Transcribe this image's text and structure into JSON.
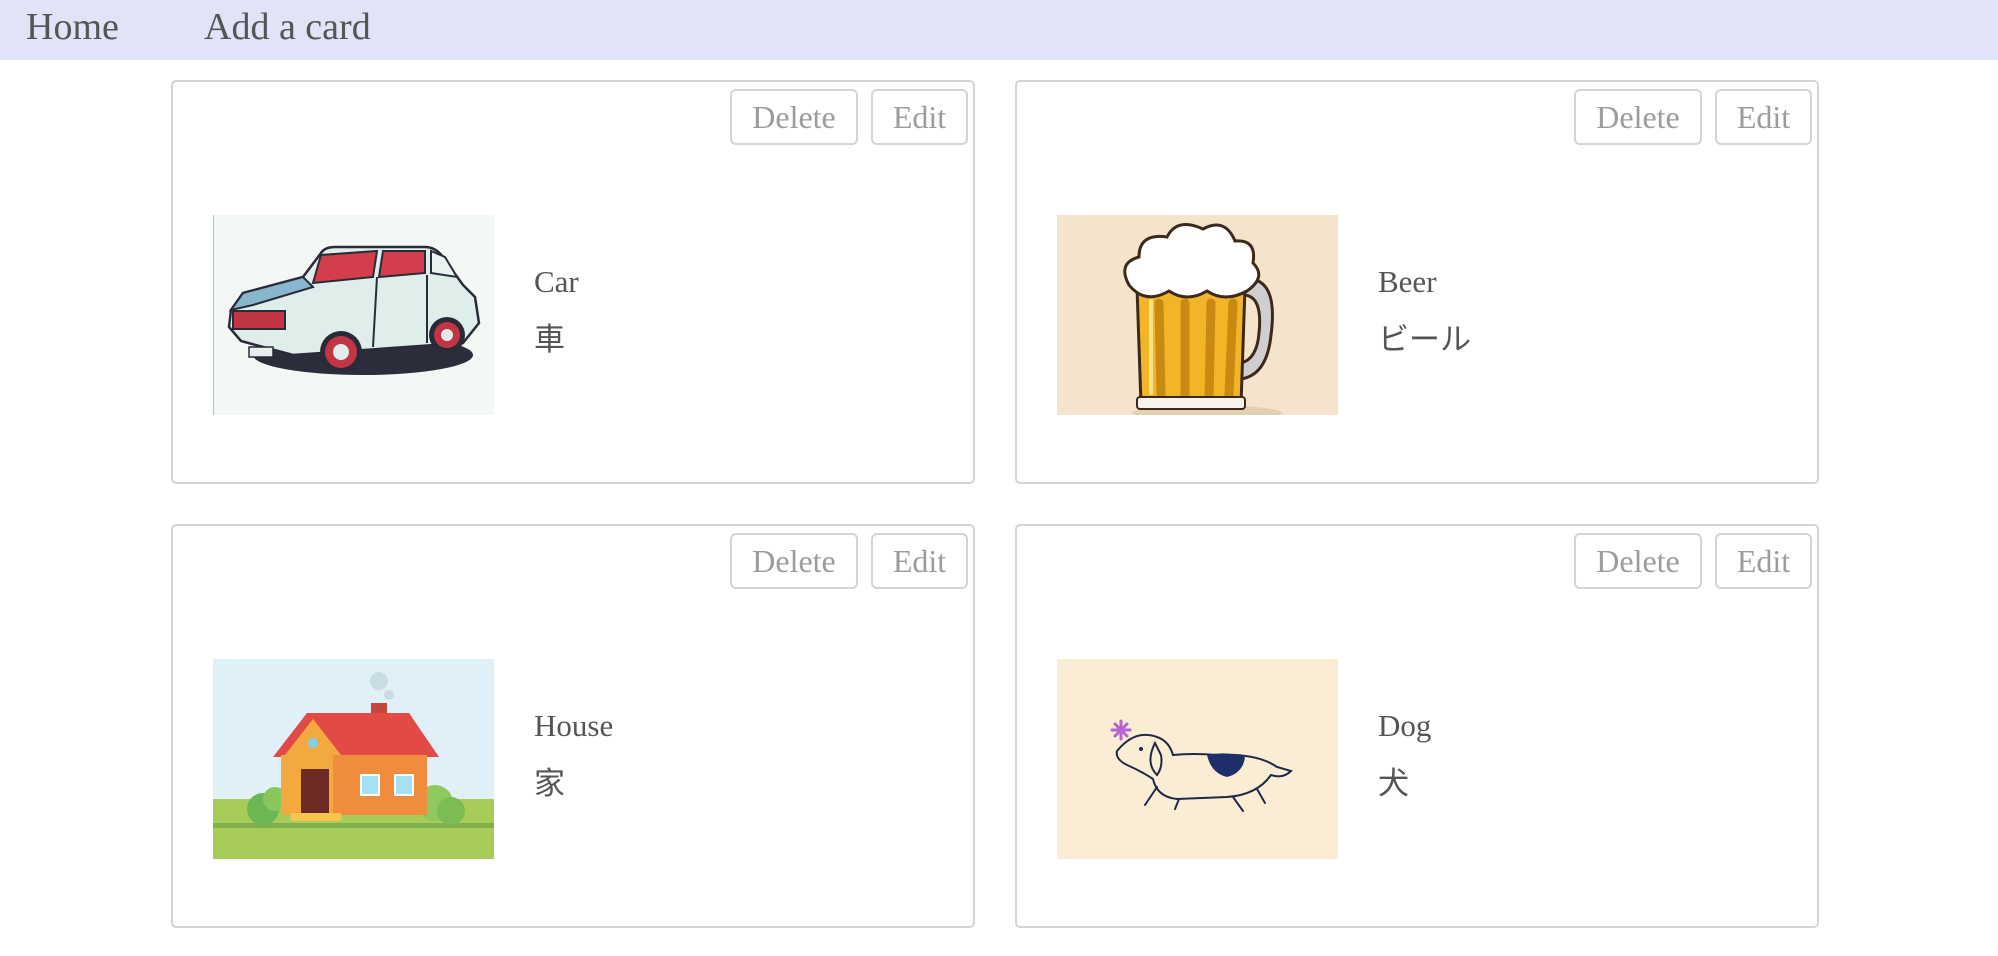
{
  "nav": {
    "home": "Home",
    "add_card": "Add a card"
  },
  "colors": {
    "navbar_bg": "#e1e3f6",
    "card_border": "#d4d4d4",
    "button_text": "#9c9c9c",
    "text": "#555555"
  },
  "cards": [
    {
      "english": "Car",
      "japanese": "車",
      "image": "car-illustration",
      "delete_label": "Delete",
      "edit_label": "Edit"
    },
    {
      "english": "Beer",
      "japanese": "ビール",
      "image": "beer-mug-illustration",
      "delete_label": "Delete",
      "edit_label": "Edit"
    },
    {
      "english": "House",
      "japanese": "家",
      "image": "house-illustration",
      "delete_label": "Delete",
      "edit_label": "Edit"
    },
    {
      "english": "Dog",
      "japanese": "犬",
      "image": "dog-illustration",
      "delete_label": "Delete",
      "edit_label": "Edit"
    }
  ]
}
